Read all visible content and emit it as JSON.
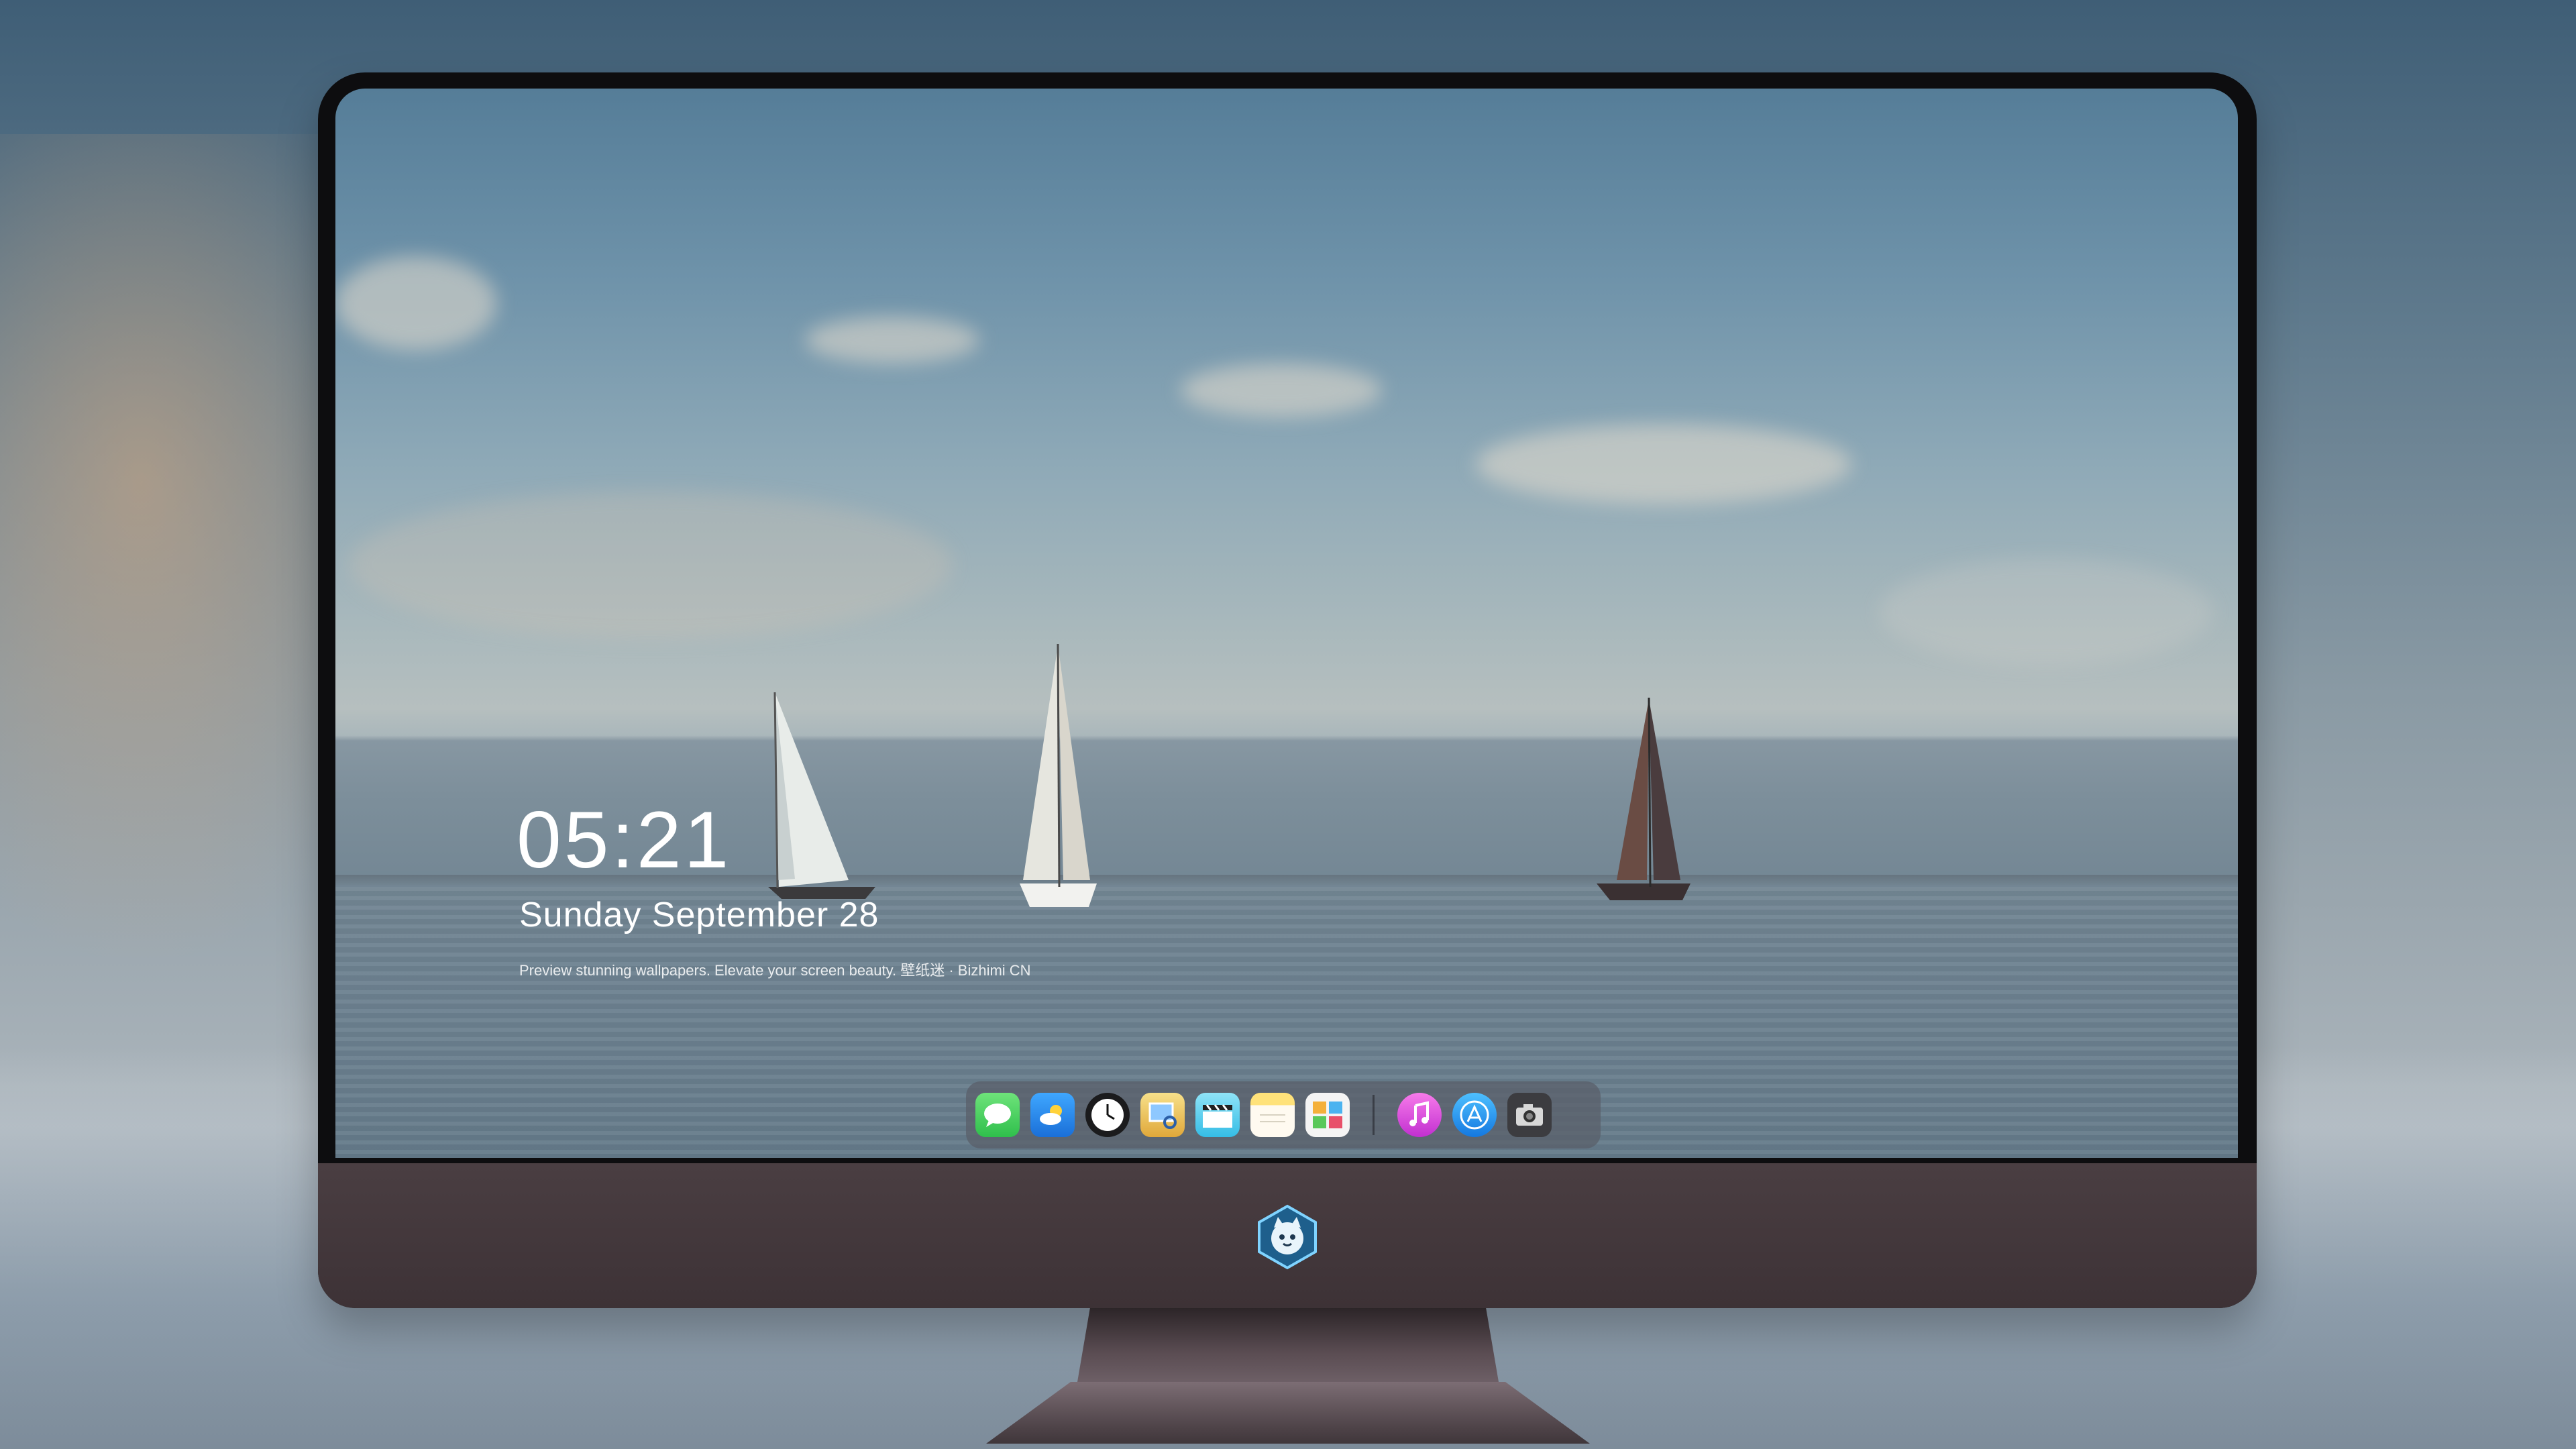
{
  "lockscreen": {
    "time": "05:21",
    "date": "Sunday September  28",
    "caption": "Preview stunning wallpapers. Elevate your screen beauty. 壁纸迷 · Bizhimi CN"
  },
  "dock": {
    "apps": [
      {
        "name": "Messages",
        "icon": "messages-icon",
        "color": "#3fd160"
      },
      {
        "name": "Weather",
        "icon": "weather-icon",
        "color": "#2f8ef0"
      },
      {
        "name": "Clock",
        "icon": "clock-icon",
        "color": "#1a1a1a"
      },
      {
        "name": "Preview",
        "icon": "preview-icon",
        "color": "#e8c04a"
      },
      {
        "name": "Final Cut / Clips",
        "icon": "clapperboard-icon",
        "color": "#44c6e8"
      },
      {
        "name": "Notes",
        "icon": "notes-icon",
        "color": "#f5d24a"
      },
      {
        "name": "Photo Booth",
        "icon": "photo-app-icon",
        "color": "#f2f2f2"
      },
      {
        "name": "iTunes",
        "icon": "music-icon",
        "color": "#e341d6"
      },
      {
        "name": "App Store",
        "icon": "app-store-icon",
        "color": "#1f9ff2"
      },
      {
        "name": "Camera",
        "icon": "camera-icon",
        "color": "#3a3a3e"
      }
    ]
  },
  "monitor": {
    "logo_icon": "cat-mascot-logo-icon"
  }
}
